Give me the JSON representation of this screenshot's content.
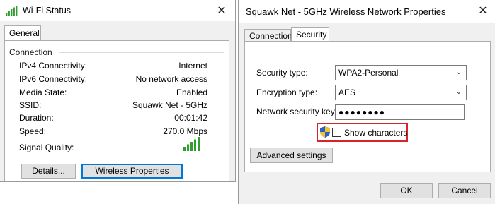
{
  "wifi_status": {
    "title": "Wi-Fi Status",
    "tabs": [
      {
        "label": "General"
      }
    ],
    "group_title": "Connection",
    "rows": [
      {
        "label": "IPv4 Connectivity:",
        "value": "Internet"
      },
      {
        "label": "IPv6 Connectivity:",
        "value": "No network access"
      },
      {
        "label": "Media State:",
        "value": "Enabled"
      },
      {
        "label": "SSID:",
        "value": "Squawk Net - 5GHz"
      },
      {
        "label": "Duration:",
        "value": "00:01:42"
      },
      {
        "label": "Speed:",
        "value": "270.0 Mbps"
      }
    ],
    "signal_label": "Signal Quality:",
    "signal_bars": 5,
    "details_button": "Details...",
    "wireless_props_button": "Wireless Properties"
  },
  "properties": {
    "title": "Squawk Net - 5GHz Wireless Network Properties",
    "tabs": [
      {
        "label": "Connection"
      },
      {
        "label": "Security"
      }
    ],
    "security_type_label": "Security type:",
    "security_type_value": "WPA2-Personal",
    "encryption_type_label": "Encryption type:",
    "encryption_type_value": "AES",
    "network_key_label": "Network security key",
    "network_key_value": "●●●●●●●●",
    "show_characters_label": "Show characters",
    "show_characters_checked": false,
    "advanced_button": "Advanced settings",
    "ok_button": "OK",
    "cancel_button": "Cancel"
  },
  "colors": {
    "accent": "#0078d7",
    "highlight": "#d9232b",
    "signal": "#2e9e2e"
  }
}
